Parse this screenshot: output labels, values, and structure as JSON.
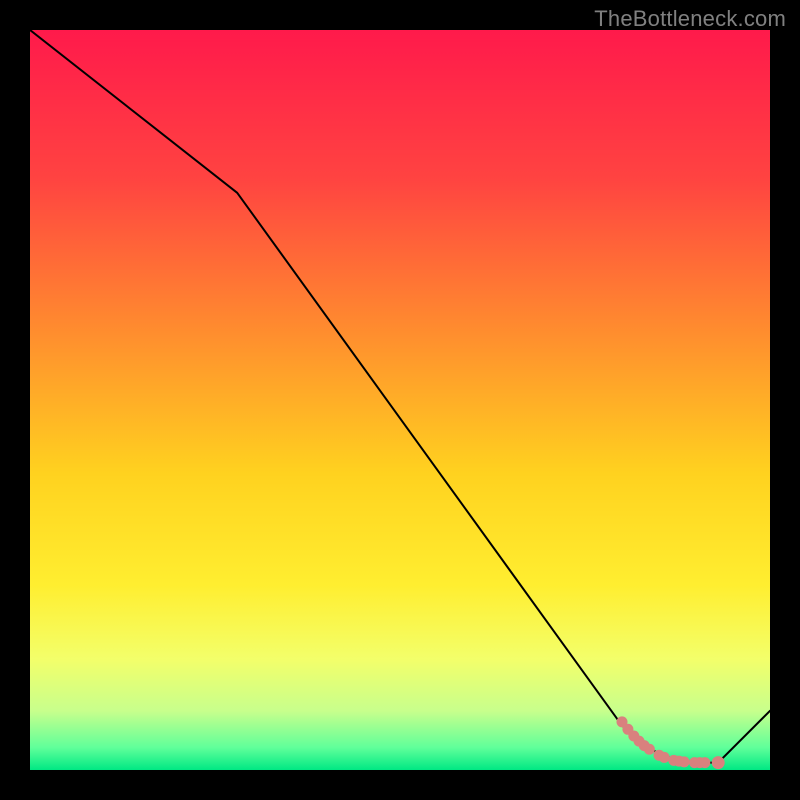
{
  "watermark": "TheBottleneck.com",
  "chart_data": {
    "type": "line",
    "title": "",
    "xlabel": "",
    "ylabel": "",
    "xlim": [
      0,
      100
    ],
    "ylim": [
      0,
      100
    ],
    "background_gradient": {
      "stops": [
        {
          "offset": 0,
          "color": "#ff1a4b"
        },
        {
          "offset": 20,
          "color": "#ff4341"
        },
        {
          "offset": 40,
          "color": "#ff8a2f"
        },
        {
          "offset": 60,
          "color": "#ffd21f"
        },
        {
          "offset": 75,
          "color": "#ffee30"
        },
        {
          "offset": 85,
          "color": "#f3ff6a"
        },
        {
          "offset": 92,
          "color": "#c8ff8c"
        },
        {
          "offset": 97,
          "color": "#5fff9a"
        },
        {
          "offset": 100,
          "color": "#00e884"
        }
      ]
    },
    "series": [
      {
        "name": "bottleneck-curve",
        "x": [
          0,
          28,
          80,
          82,
          83,
          84,
          85,
          86,
          87,
          88,
          89,
          90,
          91,
          92,
          93,
          100
        ],
        "y": [
          100,
          78,
          6,
          4.5,
          3.5,
          2.8,
          2.2,
          1.8,
          1.5,
          1.3,
          1.1,
          1.0,
          1.0,
          1.0,
          1.0,
          8
        ]
      }
    ],
    "markers": {
      "name": "highlighted-range",
      "color": "#d9817e",
      "points": [
        {
          "x": 80.0,
          "y": 6.5
        },
        {
          "x": 80.8,
          "y": 5.5
        },
        {
          "x": 81.6,
          "y": 4.6
        },
        {
          "x": 82.3,
          "y": 3.9
        },
        {
          "x": 83.0,
          "y": 3.3
        },
        {
          "x": 83.7,
          "y": 2.8
        },
        {
          "x": 85.0,
          "y": 2.0
        },
        {
          "x": 85.7,
          "y": 1.7
        },
        {
          "x": 87.0,
          "y": 1.3
        },
        {
          "x": 87.7,
          "y": 1.2
        },
        {
          "x": 88.4,
          "y": 1.1
        },
        {
          "x": 89.8,
          "y": 1.0
        },
        {
          "x": 90.5,
          "y": 1.0
        },
        {
          "x": 91.2,
          "y": 1.0
        },
        {
          "x": 93.0,
          "y": 1.0
        }
      ]
    }
  }
}
